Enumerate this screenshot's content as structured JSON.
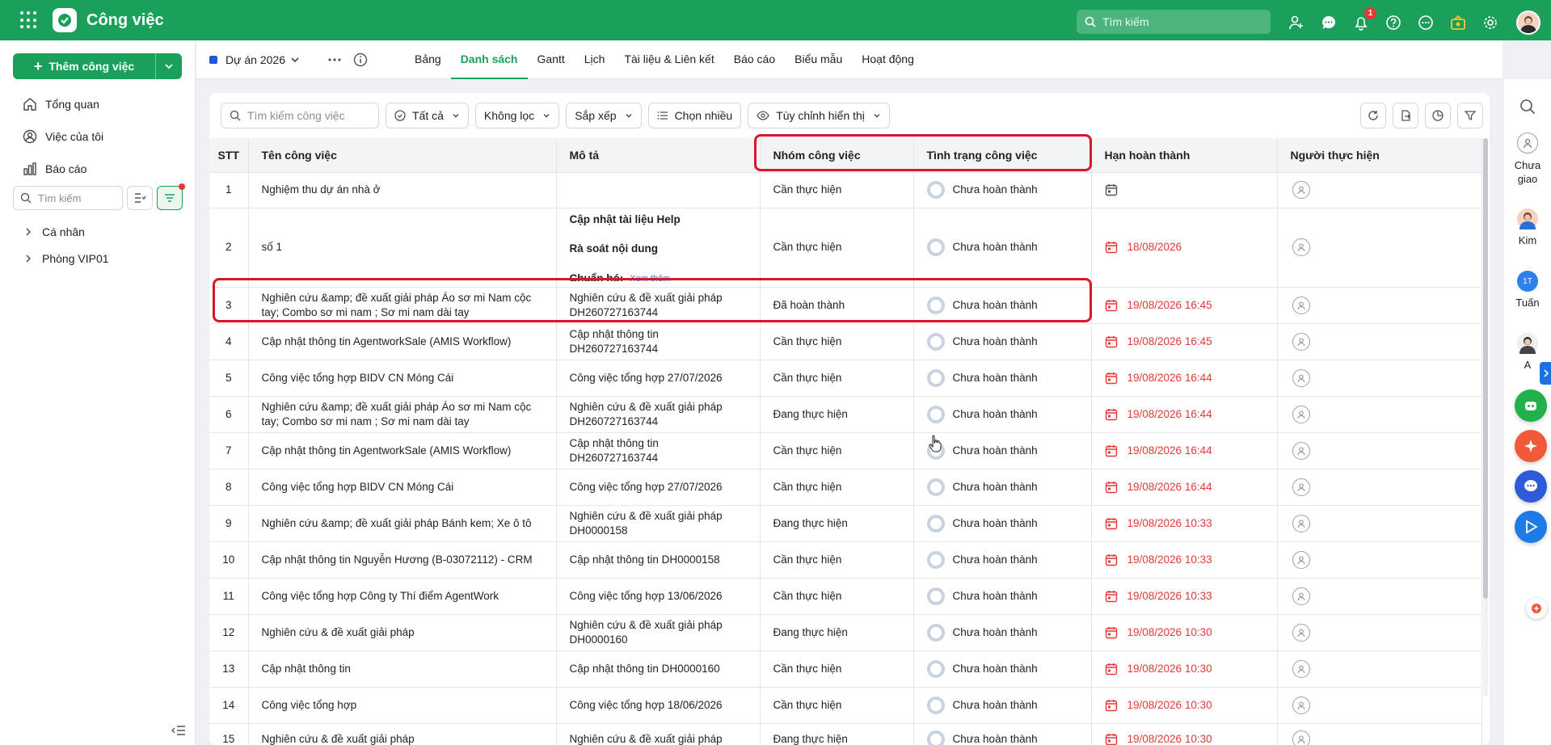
{
  "app": {
    "title": "Công việc"
  },
  "topbar": {
    "search_placeholder": "Tìm kiếm",
    "notification_count": "1"
  },
  "sidebar": {
    "add_button": "Thêm công việc",
    "nav": [
      "Tổng quan",
      "Việc của tôi",
      "Báo cáo"
    ],
    "search_placeholder": "Tìm kiếm",
    "tree": [
      "Cá nhân",
      "Phòng VIP01"
    ]
  },
  "project": {
    "name": "Dự án 2026",
    "tabs": [
      "Bảng",
      "Danh sách",
      "Gantt",
      "Lịch",
      "Tài liệu & Liên kết",
      "Báo cáo",
      "Biểu mẫu",
      "Hoạt động"
    ],
    "active_tab": "Danh sách"
  },
  "toolbar": {
    "search_placeholder": "Tìm kiếm công việc",
    "filter_all": "Tất cả",
    "no_filter": "Không lọc",
    "sort": "Sắp xếp",
    "multi_select": "Chọn nhiều",
    "customize_view": "Tùy chỉnh hiển thị"
  },
  "table": {
    "columns": [
      "STT",
      "Tên công việc",
      "Mô tả",
      "Nhóm công việc",
      "Tình trạng công việc",
      "Hạn hoàn thành",
      "Người thực hiện"
    ],
    "rows": [
      {
        "stt": "1",
        "name": "Nghiệm thu dự án nhà ở",
        "desc": "",
        "group": "Cần thực hiện",
        "status": "Chưa hoàn thành",
        "due": ""
      },
      {
        "stt": "2",
        "name": "số 1",
        "desc": "",
        "group": "Cần thực hiện",
        "status": "Chưa hoàn thành",
        "due": "18/08/2026"
      },
      {
        "stt": "3",
        "name": "Nghiên cứu &amp; đề xuất giải pháp Áo sơ mi Nam cộc tay; Combo sơ mi nam ; Sơ mi nam dài tay",
        "desc": "Nghiên cứu & đề xuất giải pháp DH260727163744",
        "group": "Đã hoàn thành",
        "status": "Chưa hoàn thành",
        "due": "19/08/2026 16:45"
      },
      {
        "stt": "4",
        "name": "Cập nhật thông tin AgentworkSale (AMIS Workflow)",
        "desc": "Cập nhật thông tin DH260727163744",
        "group": "Cần thực hiện",
        "status": "Chưa hoàn thành",
        "due": "19/08/2026 16:45"
      },
      {
        "stt": "5",
        "name": "Công việc tổng hợp BIDV CN Móng Cái",
        "desc": "Công việc tổng hợp 27/07/2026",
        "group": "Cần thực hiện",
        "status": "Chưa hoàn thành",
        "due": "19/08/2026 16:44"
      },
      {
        "stt": "6",
        "name": "Nghiên cứu &amp; đề xuất giải pháp Áo sơ mi Nam cộc tay; Combo sơ mi nam ; Sơ mi nam dài tay",
        "desc": "Nghiên cứu & đề xuất giải pháp DH260727163744",
        "group": "Đang thực hiện",
        "status": "Chưa hoàn thành",
        "due": "19/08/2026 16:44"
      },
      {
        "stt": "7",
        "name": "Cập nhật thông tin AgentworkSale (AMIS Workflow)",
        "desc": "Cập nhật thông tin DH260727163744",
        "group": "Cần thực hiện",
        "status": "Chưa hoàn thành",
        "due": "19/08/2026 16:44"
      },
      {
        "stt": "8",
        "name": "Công việc tổng hợp BIDV CN Móng Cái",
        "desc": "Công việc tổng hợp 27/07/2026",
        "group": "Cần thực hiện",
        "status": "Chưa hoàn thành",
        "due": "19/08/2026 16:44"
      },
      {
        "stt": "9",
        "name": "Nghiên cứu &amp; đề xuất giải pháp Bánh kem; Xe ô tô",
        "desc": "Nghiên cứu & đề xuất giải pháp DH0000158",
        "group": "Đang thực hiện",
        "status": "Chưa hoàn thành",
        "due": "19/08/2026 10:33"
      },
      {
        "stt": "10",
        "name": "Cập nhật thông tin Nguyễn Hương (B-03072112) - CRM",
        "desc": "Cập nhật thông tin DH0000158",
        "group": "Cần thực hiện",
        "status": "Chưa hoàn thành",
        "due": "19/08/2026 10:33"
      },
      {
        "stt": "11",
        "name": "Công việc tổng hợp Công ty Thí điểm AgentWork",
        "desc": "Công việc tổng hợp 13/06/2026",
        "group": "Cần thực hiện",
        "status": "Chưa hoàn thành",
        "due": "19/08/2026 10:33"
      },
      {
        "stt": "12",
        "name": "Nghiên cứu & đề xuất giải pháp",
        "desc": "Nghiên cứu & đề xuất giải pháp DH0000160",
        "group": "Đang thực hiện",
        "status": "Chưa hoàn thành",
        "due": "19/08/2026 10:30"
      },
      {
        "stt": "13",
        "name": "Cập nhật thông tin",
        "desc": "Cập nhật thông tin DH0000160",
        "group": "Cần thực hiện",
        "status": "Chưa hoàn thành",
        "due": "19/08/2026 10:30"
      },
      {
        "stt": "14",
        "name": "Công việc tổng hợp",
        "desc": "Công việc tổng hợp 18/06/2026",
        "group": "Cần thực hiện",
        "status": "Chưa hoàn thành",
        "due": "19/08/2026 10:30"
      },
      {
        "stt": "15",
        "name": "Nghiên cứu & đề xuất giải pháp",
        "desc": "Nghiên cứu & đề xuất giải pháp",
        "group": "Đang thực hiện",
        "status": "Chưa hoàn thành",
        "due": "19/08/2026 10:30"
      }
    ],
    "row2_desc": {
      "line1": "Cập nhật tài liệu Help",
      "line2": "Rà soát nội dung",
      "line3": "Chuẩn hó:",
      "more": "Xem thêm"
    }
  },
  "right_rail": {
    "users": [
      "Chưa giao",
      "Kim",
      "Tuấn",
      "A"
    ],
    "tuan_initials": "1T"
  },
  "colors": {
    "brand": "#1aa05a",
    "due_red": "#e53935",
    "highlight": "#d9162b"
  }
}
